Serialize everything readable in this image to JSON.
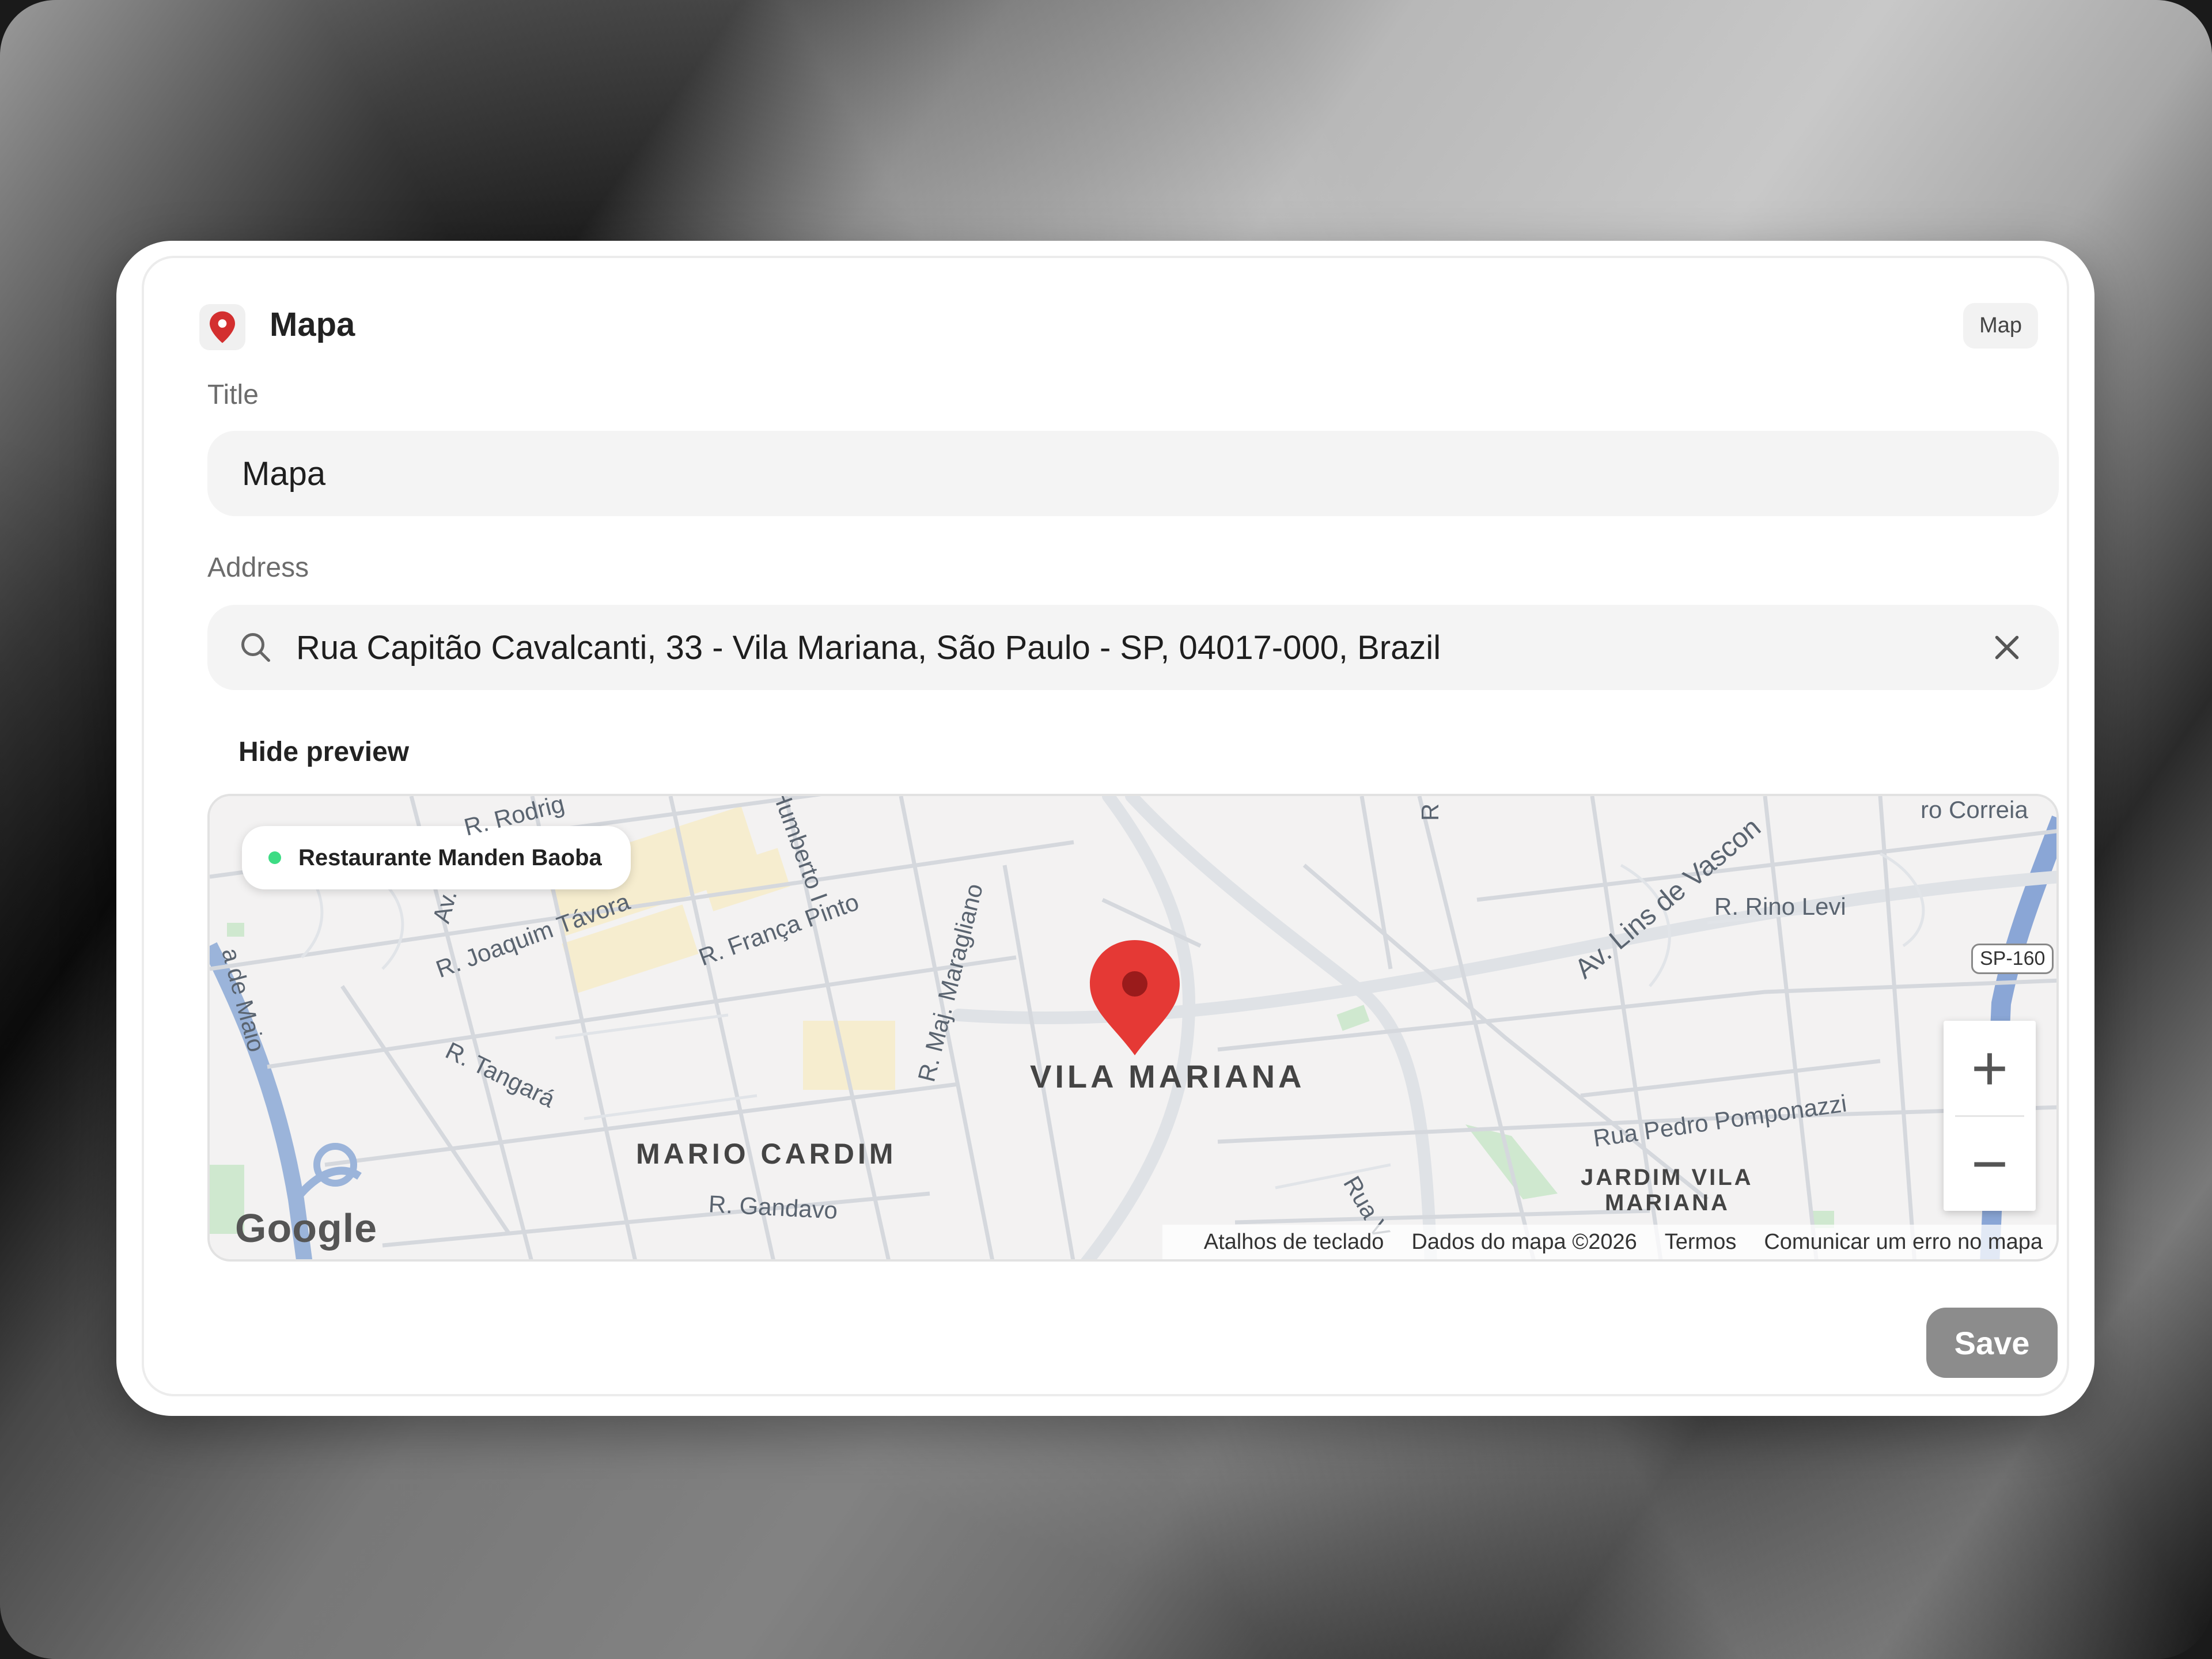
{
  "header": {
    "title": "Mapa",
    "icon": "map-pin-icon",
    "badge": "Map"
  },
  "form": {
    "title_label": "Title",
    "title_value": "Mapa",
    "address_label": "Address",
    "address_value": "Rua Capitão Cavalcanti, 33 - Vila Mariana, São Paulo - SP, 04017-000, Brazil",
    "search_icon": "search-icon",
    "clear_icon": "close-icon",
    "hide_preview_label": "Hide preview",
    "save_label": "Save"
  },
  "map": {
    "place_chip": "Restaurante Manden Baoba",
    "district_main": "VILA MARIANA",
    "district_2": "MARIO CARDIM",
    "district_3_line1": "JARDIM VILA",
    "district_3_line2": "MARIANA",
    "streets": {
      "joaquim_tavora": "R. Joaquim Távora",
      "franca_pinto": "R. França Pinto",
      "tangara": "R. Tangará",
      "gandavo": "R. Gandavo",
      "maj_maragliano": "R. Maj. Maragliano",
      "lins_de_vasconcelos": "Av. Lins de Vascon",
      "rino_levi": "R. Rino Levi",
      "pedro_pomponazzi": "Rua Pedro Pomponazzi",
      "humberto": "Humberto I",
      "rodrigues": "R. Rodrig",
      "de_maio": "a de Maio",
      "correia": "ro Correia",
      "rua": "Rua V",
      "av": "Av.",
      "r": "R"
    },
    "highway_badge": "SP-160",
    "zoom_in": "+",
    "zoom_out": "−",
    "google_logo": "Google",
    "attribution": {
      "shortcuts": "Atalhos de teclado",
      "data": "Dados do mapa ©2026",
      "terms": "Termos",
      "report": "Comunicar um erro no mapa"
    },
    "pin_color": "#e53935"
  },
  "colors": {
    "save_button": "#8c8c8c",
    "chip_dot": "#3ddc84"
  }
}
